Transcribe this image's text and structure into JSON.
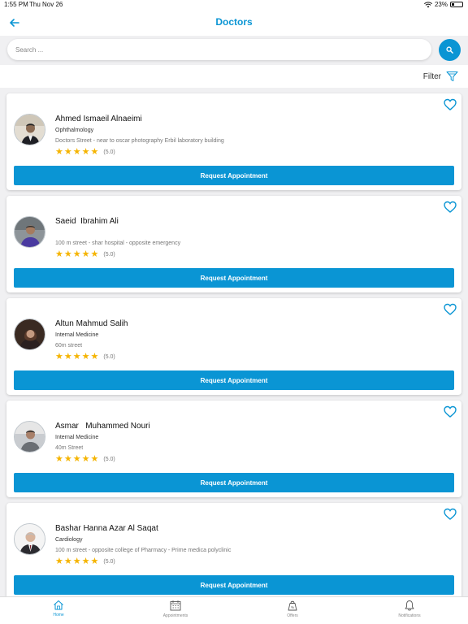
{
  "status_bar": {
    "time": "1:55 PM",
    "date": "Thu Nov 26",
    "battery": "23%",
    "battery_level": 0.23
  },
  "header": {
    "title": "Doctors"
  },
  "search": {
    "placeholder": "Search ..."
  },
  "filter": {
    "label": "Filter"
  },
  "colors": {
    "accent": "#0a95d4",
    "star": "#f5b400"
  },
  "doctors": [
    {
      "name": "Ahmed Ismaeil Alnaeimi",
      "specialty": "Ophthalmology",
      "address": "Doctors Street - near to oscar photography Erbil laboratory building",
      "rating_text": "(5.0)",
      "rating": 5,
      "button": "Request Appointment"
    },
    {
      "name": "Saeid  Ibrahim Ali",
      "specialty": "",
      "address": "100 m street - shar hospital - opposite emergency",
      "rating_text": "(5.0)",
      "rating": 5,
      "button": "Request Appointment"
    },
    {
      "name": "Altun Mahmud Salih",
      "specialty": "Internal Medicine",
      "address": "60m street",
      "rating_text": "(5.0)",
      "rating": 5,
      "button": "Request Appointment"
    },
    {
      "name": "Asmar   Muhammed Nouri",
      "specialty": "Internal Medicine",
      "address": "40m Street",
      "rating_text": "(5.0)",
      "rating": 5,
      "button": "Request Appointment"
    },
    {
      "name": "Bashar Hanna Azar Al Saqat",
      "specialty": "Cardiology",
      "address": "100 m street - opposite college of Pharmacy - Prime medica polyclinic",
      "rating_text": "(5.0)",
      "rating": 5,
      "button": "Request Appointment"
    }
  ],
  "tabs": [
    {
      "label": "Home",
      "icon": "home-icon",
      "active": true
    },
    {
      "label": "Appointments",
      "icon": "calendar-icon",
      "active": false
    },
    {
      "label": "Offers",
      "icon": "offers-icon",
      "active": false
    },
    {
      "label": "Notifications",
      "icon": "bell-icon",
      "active": false
    }
  ]
}
